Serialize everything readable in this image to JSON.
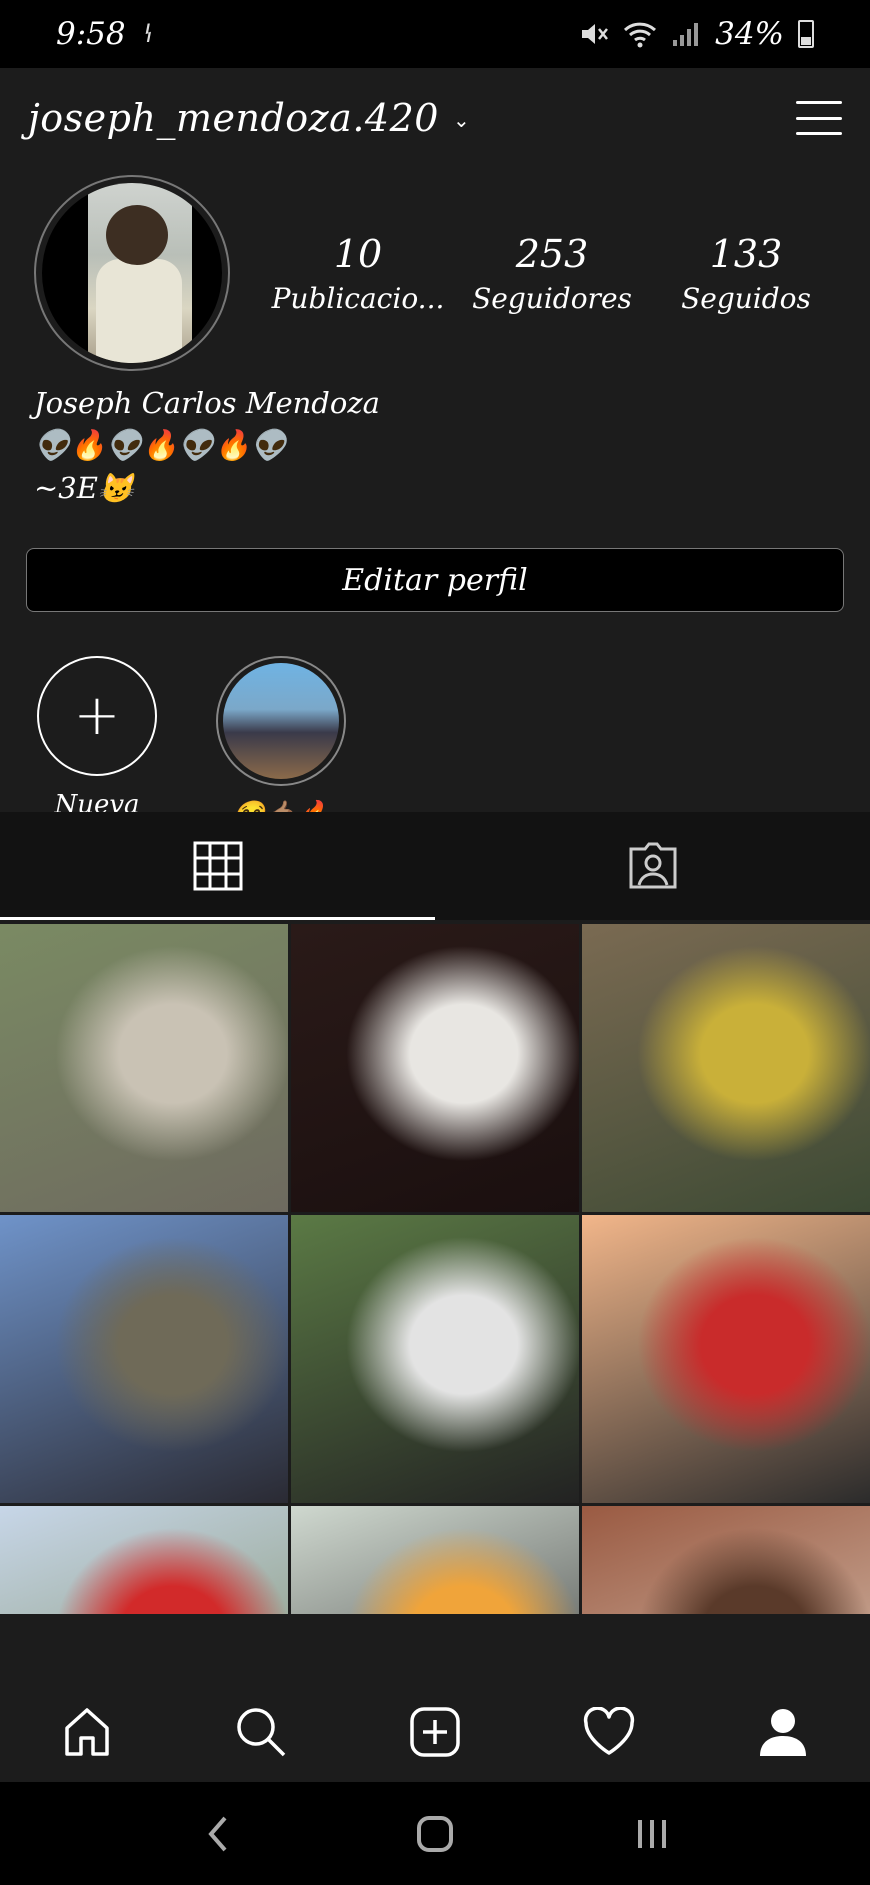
{
  "status_bar": {
    "time": "9:58",
    "carrier_glyph": "ꝇ",
    "icons": [
      "mute-icon",
      "wifi-icon",
      "signal-icon"
    ],
    "battery_percent": "34%"
  },
  "header": {
    "username": "joseph_mendoza.420"
  },
  "profile": {
    "stats": [
      {
        "value": "10",
        "label": "Publicacio..."
      },
      {
        "value": "253",
        "label": "Seguidores"
      },
      {
        "value": "133",
        "label": "Seguidos"
      }
    ],
    "full_name": "Joseph Carlos Mendoza",
    "bio_line1": "👽🔥👽🔥👽🔥👽",
    "bio_line2": "~3E😼",
    "edit_button": "Editar perfil"
  },
  "highlights": [
    {
      "label": "Nueva"
    },
    {
      "label": "😂🤙🏽🔥"
    }
  ],
  "tabs": [
    "grid-icon",
    "tagged-icon"
  ],
  "posts": [
    {
      "colors": [
        "#7a8a63",
        "#c9c2b4",
        "#6e6a5f"
      ]
    },
    {
      "colors": [
        "#2a1a18",
        "#e8e6e2",
        "#1a0f0f"
      ]
    },
    {
      "colors": [
        "#7a6a52",
        "#c9b039",
        "#3d4a34"
      ]
    },
    {
      "colors": [
        "#6f93c9",
        "#6f6a58",
        "#2a2a33"
      ]
    },
    {
      "colors": [
        "#5b7a45",
        "#e3e3e3",
        "#222222"
      ]
    },
    {
      "colors": [
        "#f2b68a",
        "#c92b2b",
        "#2b2b2b"
      ]
    },
    {
      "colors": [
        "#c7d6e8",
        "#d22a2a",
        "#7a8a60"
      ]
    },
    {
      "colors": [
        "#cfd8cf",
        "#f0a43a",
        "#2e2e2e"
      ]
    },
    {
      "colors": [
        "#9a5a42",
        "#5a3a2a",
        "#e0d0c0"
      ]
    }
  ],
  "bottom_nav": [
    "home-icon",
    "search-icon",
    "add-post-icon",
    "activity-heart-icon",
    "profile-icon"
  ],
  "system_nav": [
    "back-icon",
    "home-circle-icon",
    "recents-icon"
  ]
}
